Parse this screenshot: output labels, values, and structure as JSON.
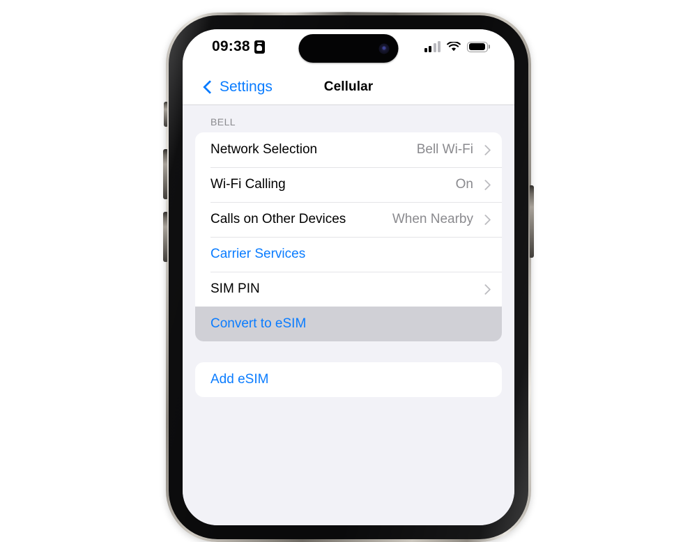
{
  "status_bar": {
    "time": "09:38",
    "badge_icon": "id-badge-icon",
    "signal_icon": "cellular-signal-icon",
    "signal_bars_filled": 2,
    "signal_bars_total": 4,
    "wifi_icon": "wifi-icon",
    "battery_icon": "battery-icon",
    "battery_level_percent": 92
  },
  "nav_bar": {
    "back_icon": "chevron-left-icon",
    "back_label": "Settings",
    "title": "Cellular"
  },
  "carrier_section": {
    "header": "BELL",
    "rows": [
      {
        "label": "Network Selection",
        "value": "Bell Wi-Fi",
        "chevron": true,
        "style": "default",
        "highlighted": false
      },
      {
        "label": "Wi-Fi Calling",
        "value": "On",
        "chevron": true,
        "style": "default",
        "highlighted": false
      },
      {
        "label": "Calls on Other Devices",
        "value": "When Nearby",
        "chevron": true,
        "style": "default",
        "highlighted": false
      },
      {
        "label": "Carrier Services",
        "value": "",
        "chevron": false,
        "style": "link",
        "highlighted": false
      },
      {
        "label": "SIM PIN",
        "value": "",
        "chevron": true,
        "style": "default",
        "highlighted": false
      },
      {
        "label": "Convert to eSIM",
        "value": "",
        "chevron": false,
        "style": "link",
        "highlighted": true
      }
    ]
  },
  "esim_section": {
    "rows": [
      {
        "label": "Add eSIM",
        "value": "",
        "chevron": false,
        "style": "link",
        "highlighted": false
      }
    ]
  },
  "colors": {
    "accent_blue": "#0a7cff",
    "page_background": "#f2f2f7",
    "card_background": "#ffffff",
    "highlight_gray": "#d0d0d6",
    "secondary_text": "#8a8a8e",
    "separator": "#e4e4e7"
  }
}
